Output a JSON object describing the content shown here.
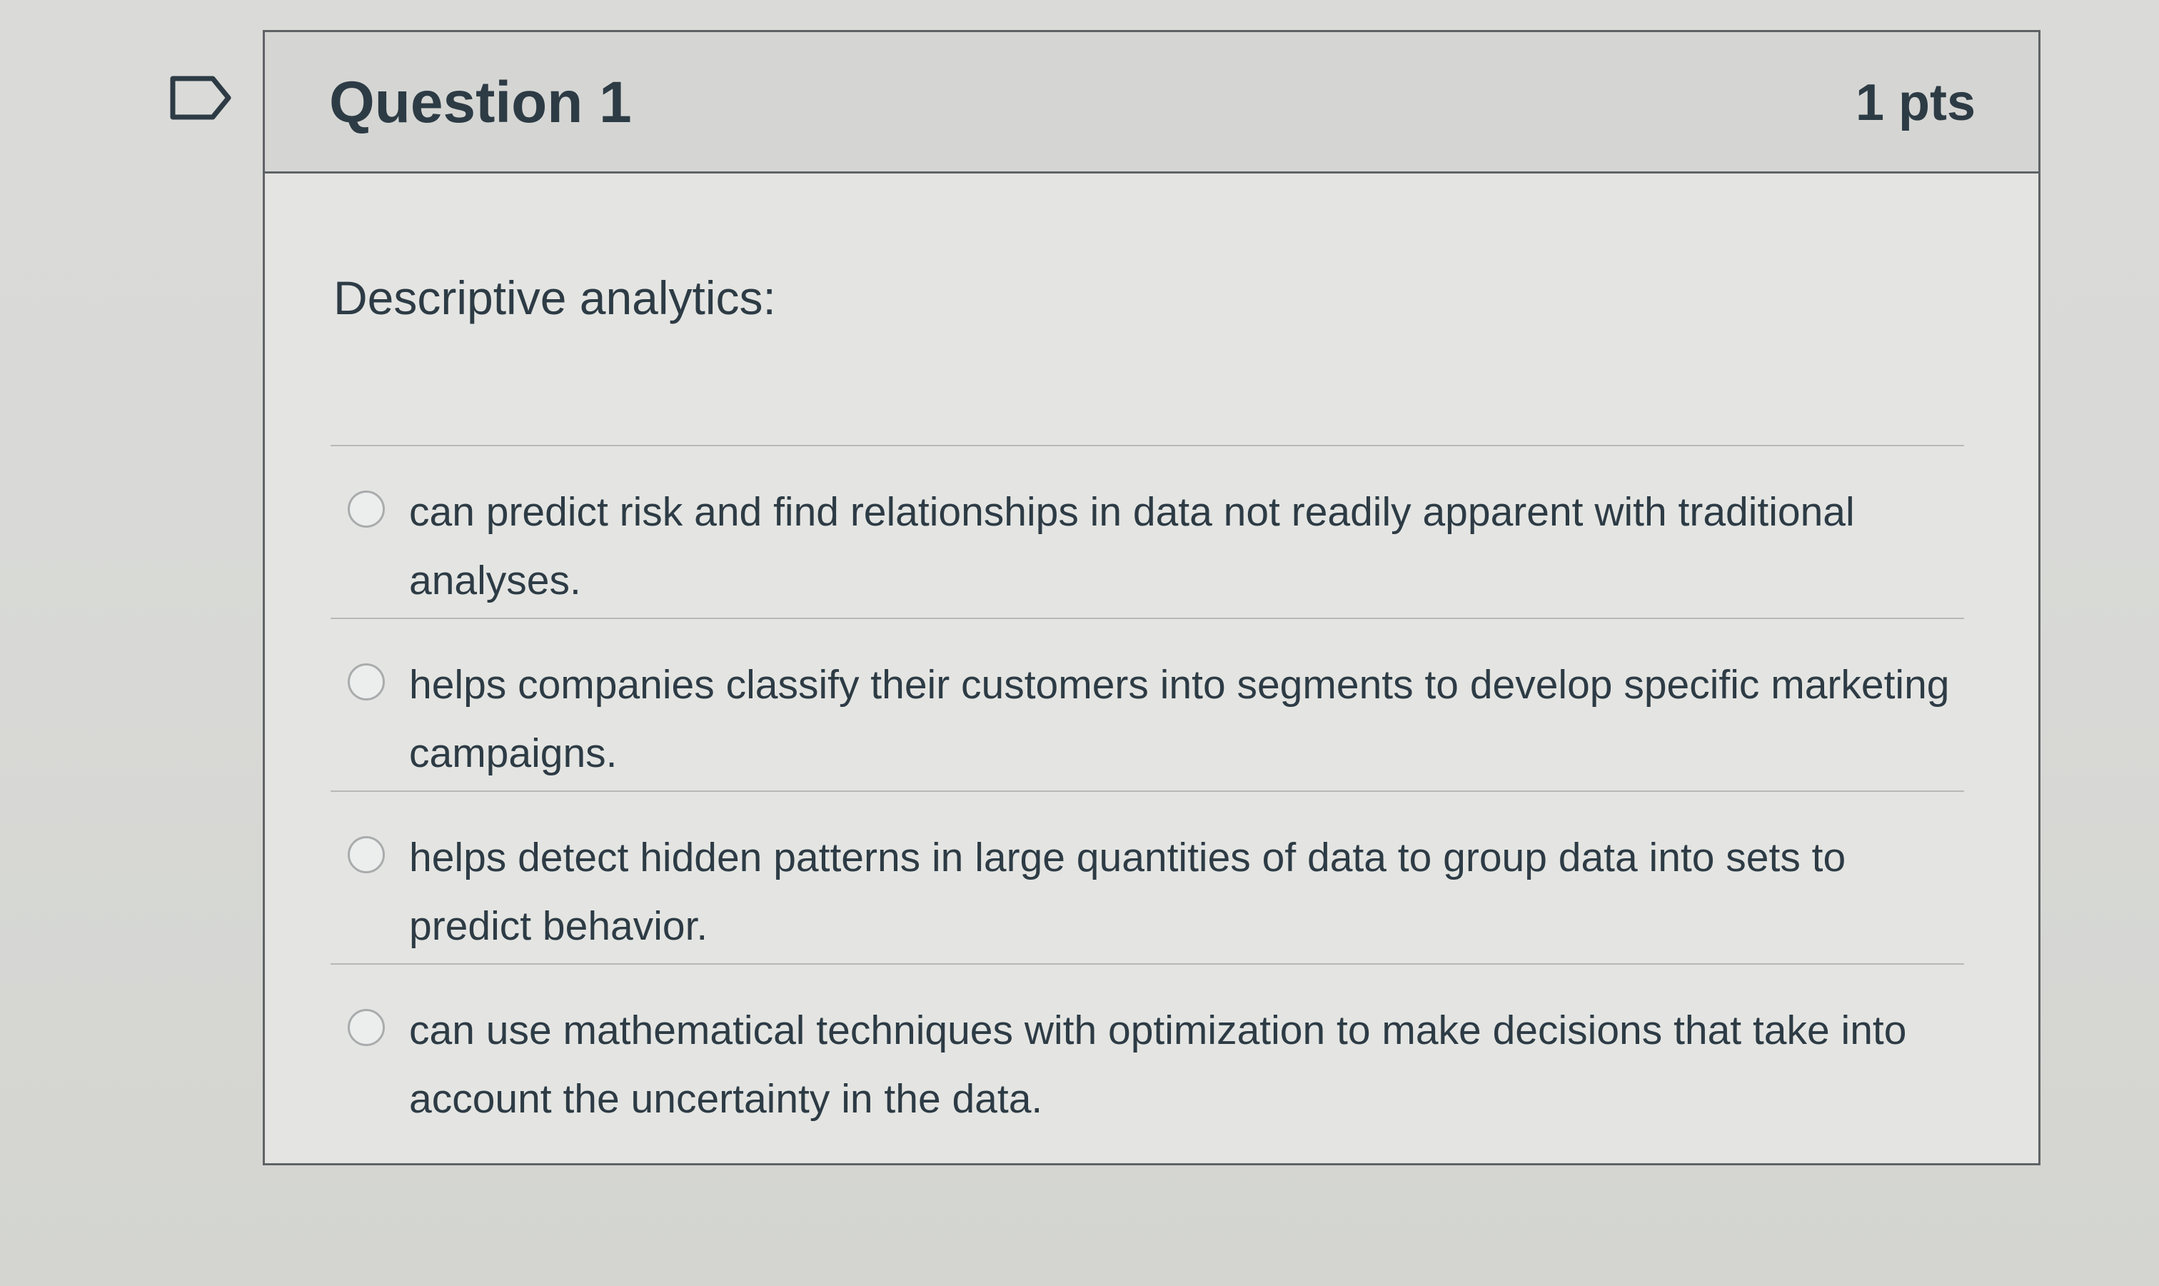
{
  "quiz": {
    "question": {
      "title": "Question 1",
      "points": "1 pts",
      "prompt": "Descriptive analytics:",
      "answers": [
        {
          "text": "can predict risk and find relationships in data not readily apparent with traditional analyses."
        },
        {
          "text": "helps companies classify their customers into segments to develop specific marketing campaigns."
        },
        {
          "text": "helps detect hidden patterns in large quantities of data to group data into sets to predict behavior."
        },
        {
          "text": "can use mathematical techniques with optimization to make decisions that take into account the uncertainty in the data."
        }
      ]
    }
  },
  "icons": {
    "bookmark": "flag-bookmark-icon",
    "radio": "radio-unselected-icon"
  },
  "colors": {
    "text": "#2d3b45",
    "border": "#5f6366",
    "header_bg": "#d5d6d3"
  }
}
